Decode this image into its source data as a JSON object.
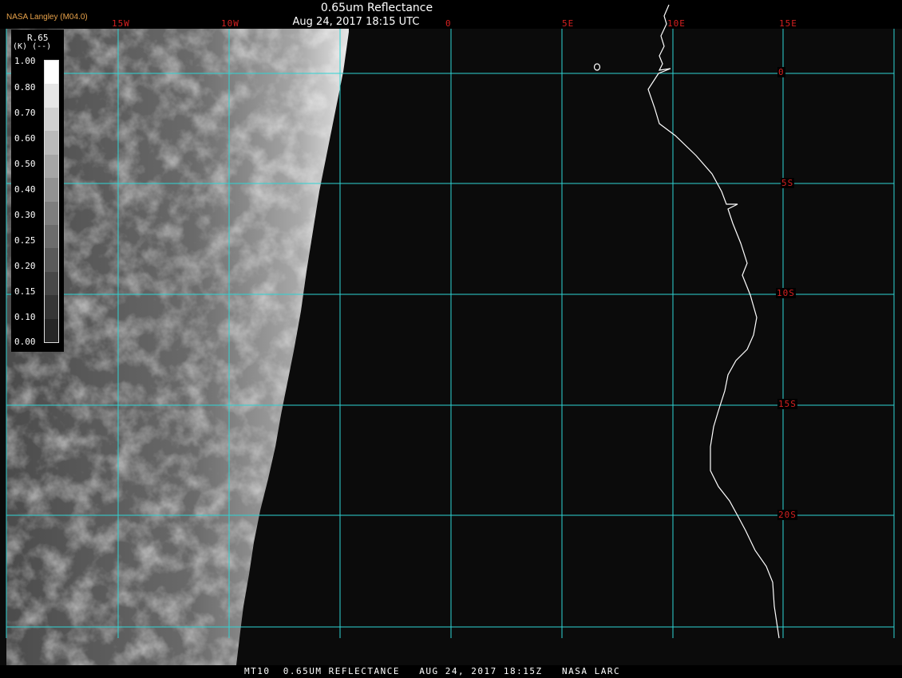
{
  "header": {
    "brand": "NASA Langley (M04.0)",
    "title": "0.65um Reflectance",
    "subtitle": "Aug 24, 2017 18:15 UTC"
  },
  "graticule": {
    "lon_labels": [
      "15W",
      "10W",
      "0",
      "5E",
      "10E",
      "15E"
    ],
    "lat_labels": [
      "0",
      "5S",
      "10S",
      "15S",
      "20S"
    ]
  },
  "legend": {
    "title": "R.65",
    "units": "(K)  (--)",
    "ticks": [
      "1.00",
      "0.80",
      "0.70",
      "0.60",
      "0.50",
      "0.40",
      "0.30",
      "0.25",
      "0.20",
      "0.15",
      "0.10",
      "0.00"
    ]
  },
  "footer": {
    "text": "MT10  0.65UM REFLECTANCE   AUG 24, 2017 18:15Z   NASA LARC"
  },
  "colors": {
    "grid": "#2fd4d4",
    "label": "#d62020",
    "coast": "#ffffff",
    "brand": "#e8a24a"
  }
}
